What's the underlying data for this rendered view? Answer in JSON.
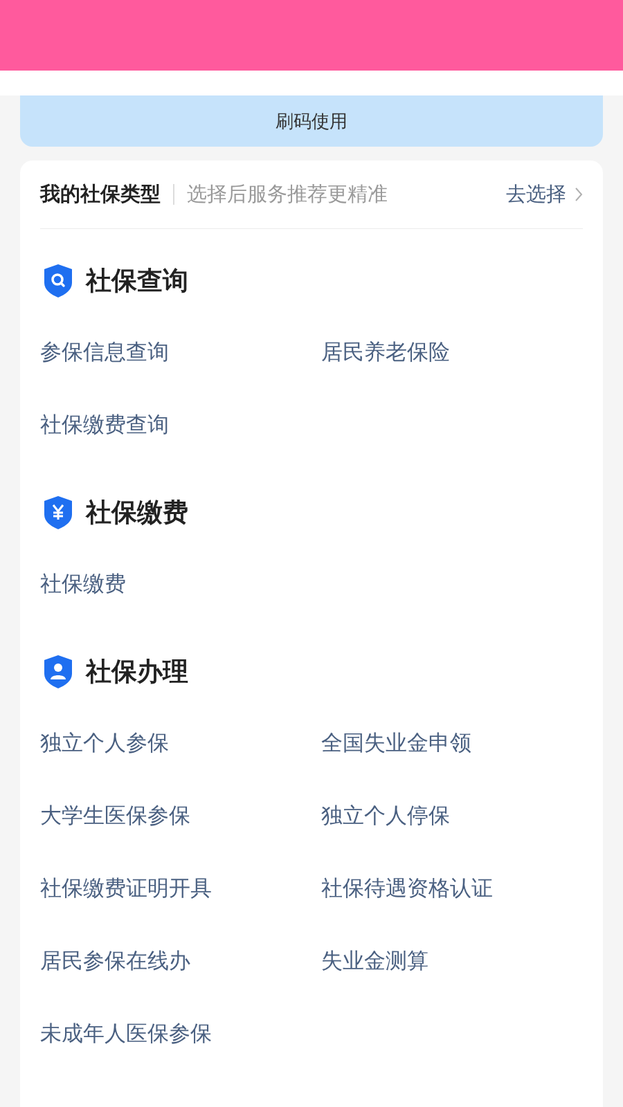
{
  "banner": {
    "label": "刷码使用"
  },
  "type_row": {
    "title": "我的社保类型",
    "hint": "选择后服务推荐更精准",
    "action": "去选择"
  },
  "sections": [
    {
      "kind": "search",
      "title": "社保查询",
      "items": [
        "参保信息查询",
        "居民养老保险",
        "社保缴费查询"
      ]
    },
    {
      "kind": "yen",
      "title": "社保缴费",
      "items": [
        "社保缴费"
      ]
    },
    {
      "kind": "person",
      "title": "社保办理",
      "items": [
        "独立个人参保",
        "全国失业金申领",
        "大学生医保参保",
        "独立个人停保",
        "社保缴费证明开具",
        "社保待遇资格认证",
        "居民参保在线办",
        "失业金测算",
        "未成年人医保参保"
      ]
    }
  ]
}
